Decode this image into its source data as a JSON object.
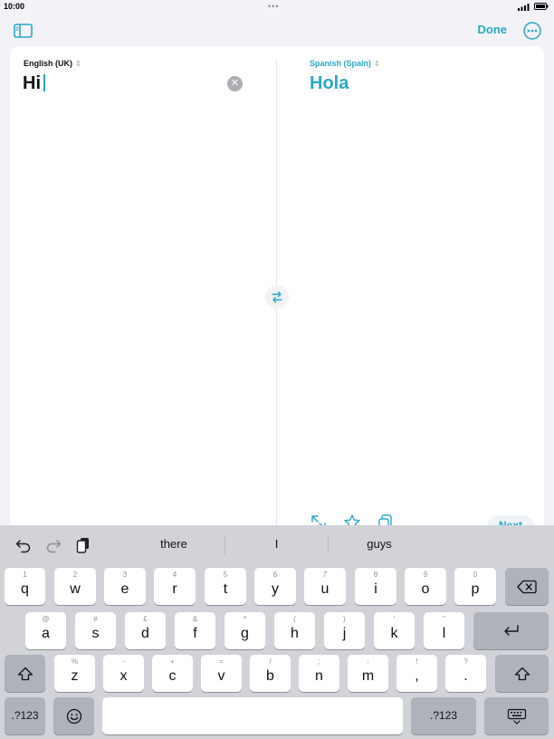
{
  "status_bar": {
    "time": "10:00",
    "dots": "•••"
  },
  "toolbar": {
    "done_label": "Done"
  },
  "source": {
    "language": "English (UK)",
    "text": "Hi",
    "chevron": "⌃⌄"
  },
  "target": {
    "language": "Spanish (Spain)",
    "text": "Hola"
  },
  "clear_glyph": "✕",
  "actions": {
    "next_label": "Next"
  },
  "suggestions": [
    "there",
    "I",
    "guys"
  ],
  "keyboard": {
    "row1": [
      {
        "k": "q",
        "s": "1"
      },
      {
        "k": "w",
        "s": "2"
      },
      {
        "k": "e",
        "s": "3"
      },
      {
        "k": "r",
        "s": "4"
      },
      {
        "k": "t",
        "s": "5"
      },
      {
        "k": "y",
        "s": "6"
      },
      {
        "k": "u",
        "s": "7"
      },
      {
        "k": "i",
        "s": "8"
      },
      {
        "k": "o",
        "s": "9"
      },
      {
        "k": "p",
        "s": "0"
      }
    ],
    "row2": [
      {
        "k": "a",
        "s": "@"
      },
      {
        "k": "s",
        "s": "#"
      },
      {
        "k": "d",
        "s": "£"
      },
      {
        "k": "f",
        "s": "&"
      },
      {
        "k": "g",
        "s": "*"
      },
      {
        "k": "h",
        "s": "("
      },
      {
        "k": "j",
        "s": ")"
      },
      {
        "k": "k",
        "s": "'"
      },
      {
        "k": "l",
        "s": "\""
      }
    ],
    "row3": [
      {
        "k": "z",
        "s": "%"
      },
      {
        "k": "x",
        "s": "-"
      },
      {
        "k": "c",
        "s": "+"
      },
      {
        "k": "v",
        "s": "="
      },
      {
        "k": "b",
        "s": "/"
      },
      {
        "k": "n",
        "s": ";"
      },
      {
        "k": "m",
        "s": ":"
      },
      {
        "k": "!",
        "s": ","
      },
      {
        "k": "?",
        "s": "."
      }
    ],
    "numbers_label": ".?123"
  },
  "colors": {
    "accent": "#2aa7c7",
    "keyboard_bg": "#d1d3d9",
    "function_key": "#adb2bb"
  }
}
